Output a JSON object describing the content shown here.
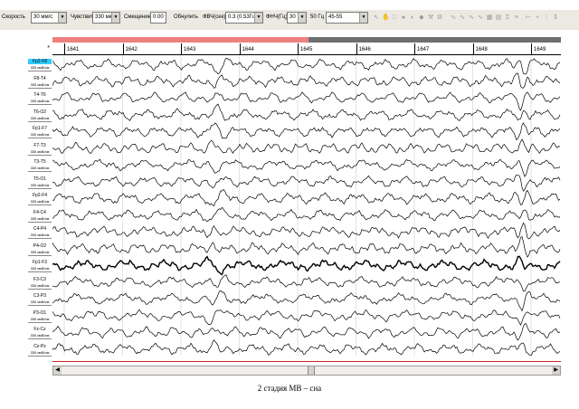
{
  "toolbar": {
    "speed_label": "Скорость",
    "speed_value": "30 мм/с",
    "sensitivity_label": "Чувствит",
    "sensitivity_value": "330 мкВ/с",
    "offset_label": "Смещение",
    "offset_value": "0.00",
    "detect_button": "Обнулить",
    "hpf_label": "ФВЧ(сек)",
    "hpf_value": "0.3 (0.53Гц)",
    "lpf_label": "ФНЧ(Гц)",
    "lpf_value": "30",
    "notch_label": "50 Гц",
    "band_value": "45-55"
  },
  "ruler": {
    "corner": "*",
    "ticks": [
      "1641",
      "1642",
      "1643",
      "1644",
      "1645",
      "1646",
      "1647",
      "1648",
      "1649"
    ]
  },
  "channels": [
    {
      "name": "Fp2-F8",
      "unit": "330 мкВ/см",
      "selected": true
    },
    {
      "name": "F8-T4",
      "unit": "330 мкВ/см"
    },
    {
      "name": "T4-T6",
      "unit": "330 мкВ/см"
    },
    {
      "name": "T6-O2",
      "unit": "330 мкВ/см"
    },
    {
      "name": "Fp1-F7",
      "unit": "330 мкВ/см"
    },
    {
      "name": "F7-T3",
      "unit": "330 мкВ/см"
    },
    {
      "name": "T3-T5",
      "unit": "330 мкВ/см"
    },
    {
      "name": "T5-O1",
      "unit": "330 мкВ/см"
    },
    {
      "name": "Fp2-F4",
      "unit": "330 мкВ/см"
    },
    {
      "name": "F4-C4",
      "unit": "330 мкВ/см"
    },
    {
      "name": "C4-P4",
      "unit": "330 мкВ/см"
    },
    {
      "name": "P4-O2",
      "unit": "330 мкВ/см"
    },
    {
      "name": "Fp1-F3",
      "unit": "330 мкВ/см"
    },
    {
      "name": "F3-C3",
      "unit": "330 мкВ/см"
    },
    {
      "name": "C3-P3",
      "unit": "330 мкВ/см"
    },
    {
      "name": "P3-O1",
      "unit": "330 мкВ/см"
    },
    {
      "name": "Fz-Cz",
      "unit": "330 мкВ/см"
    },
    {
      "name": "Cz-Pz",
      "unit": "330 мкВ/см"
    }
  ],
  "colors": {
    "selected_channel": "#33ccff",
    "epoch_marker": "#f08080",
    "epoch_bar": "#6e6e6e",
    "baseline": "#d02020"
  },
  "icons": [
    "cursor-icon",
    "hand-icon",
    "rect-icon",
    "circle-icon",
    "fill-icon",
    "measure-icon",
    "settings-icon",
    "grid-icon",
    "sum-icon",
    "wave-icon"
  ],
  "caption": "2 стадия МВ – сна"
}
